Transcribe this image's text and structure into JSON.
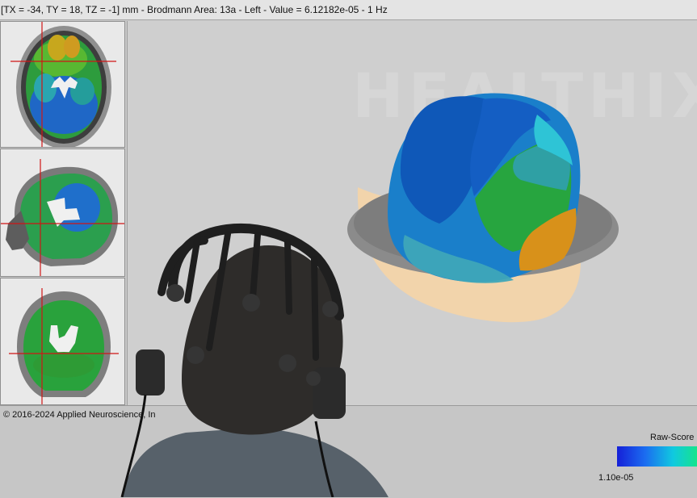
{
  "title_bar": {
    "text": "[TX = -34, TY = 18, TZ = -1] mm - Brodmann Area: 13a - Left - Value = 6.12182e-05 - 1 Hz"
  },
  "watermark": {
    "text": "HEALTHIX"
  },
  "footer": {
    "copyright": "© 2016-2024 Applied Neuroscience, In"
  },
  "color_scale": {
    "label": "Raw-Score",
    "min_label": "1.10e-05",
    "colors": [
      "#1520d8",
      "#1b6cf0",
      "#10c9e0",
      "#16e48c"
    ]
  },
  "views": {
    "axial": "axial",
    "sagittal": "sagittal",
    "coronal": "coronal"
  },
  "accent_colors": {
    "crosshair": "#d01515"
  }
}
